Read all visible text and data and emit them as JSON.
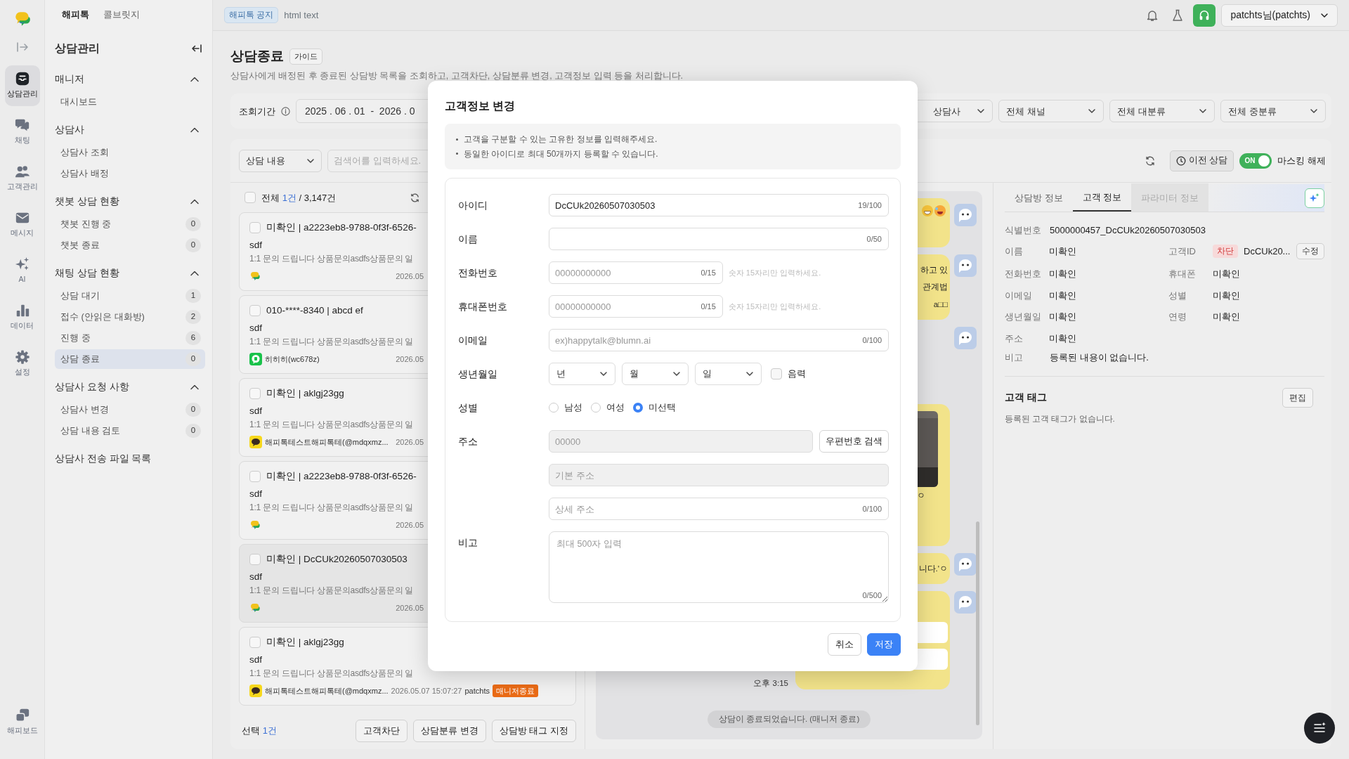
{
  "rail": {
    "items": [
      {
        "label": "상담관리",
        "selected": true
      },
      {
        "label": "채팅",
        "selected": false
      },
      {
        "label": "고객관리",
        "selected": false
      },
      {
        "label": "메시지",
        "selected": false
      },
      {
        "label": "AI",
        "selected": false
      },
      {
        "label": "데이터",
        "selected": false
      },
      {
        "label": "설정",
        "selected": false
      }
    ],
    "bottom": {
      "label": "해피보드"
    }
  },
  "sidebar": {
    "tabs": [
      {
        "label": "해피톡",
        "selected": true
      },
      {
        "label": "콜브릿지",
        "selected": false
      }
    ],
    "title": "상담관리",
    "groups": [
      {
        "title": "매니저",
        "expanded": true,
        "items": [
          {
            "label": "대시보드",
            "selected": false
          }
        ]
      },
      {
        "title": "상담사",
        "expanded": true,
        "items": [
          {
            "label": "상담사 조회",
            "selected": false
          },
          {
            "label": "상담사 배정",
            "selected": false
          }
        ]
      },
      {
        "title": "챗봇 상담 현황",
        "expanded": true,
        "items": [
          {
            "label": "챗봇 진행 중",
            "count": "0",
            "selected": false
          },
          {
            "label": "챗봇 종료",
            "count": "0",
            "selected": false
          }
        ]
      },
      {
        "title": "채팅 상담 현황",
        "expanded": true,
        "items": [
          {
            "label": "상담 대기",
            "count": "1",
            "selected": false
          },
          {
            "label": "접수 (안읽은 대화방)",
            "count": "2",
            "selected": false
          },
          {
            "label": "진행 중",
            "count": "6",
            "selected": false
          },
          {
            "label": "상담 종료",
            "count": "0",
            "selected": true
          }
        ]
      },
      {
        "title": "상담사 요청 사항",
        "expanded": true,
        "items": [
          {
            "label": "상담사 변경",
            "count": "0",
            "selected": false
          },
          {
            "label": "상담 내용 검토",
            "count": "0",
            "selected": false
          }
        ]
      }
    ],
    "links": [
      "상담사 전송 파일 목록"
    ]
  },
  "topbar": {
    "notice_badge": "해피톡 공지",
    "notice_text": "html text",
    "user": "patchts님(patchts)"
  },
  "page": {
    "title": "상담종료",
    "guide": "가이드",
    "description": "상담사에게 배정된 후 종료된 상담방 목록을 조회하고, 고객차단, 상담분류 변경, 고객정보 입력 등을 처리합니다."
  },
  "filters": {
    "period_label": "조회기간",
    "date_range": "2025 . 06 . 01  -  2026 . 0",
    "selects": [
      "상담사",
      "전체 채널",
      "전체 대분류",
      "전체 중분류"
    ]
  },
  "toolbar": {
    "search_type": "상담 내용",
    "search": {
      "placeholder": "검색어를 입력하세요."
    },
    "previous_button": "이전 상담",
    "masking": {
      "switch": "ON",
      "on": true,
      "label": "마스킹 해제"
    }
  },
  "list": {
    "checked": false,
    "total_label": "전체",
    "matched": "1건",
    "total": "/ 3,147건",
    "items": [
      {
        "title": "미확인 | a2223eb8-9788-0f3f-6526-",
        "subject": "sdf",
        "preview": "1:1 문의 드립니다 상품문의asdfs상품문의 일",
        "kind": "happytalk",
        "date": "2026.05",
        "checked": false,
        "selected": false
      },
      {
        "title": "010-****-8340 | abcd ef",
        "subject": "sdf",
        "preview": "1:1 문의 드립니다 상품문의asdfs상품문의 일",
        "kind": "naver",
        "channel_name": "히히히(wc678z)",
        "date": "2026.05",
        "checked": false,
        "selected": false
      },
      {
        "title": "미확인 | aklgj23gg",
        "subject": "sdf",
        "preview": "1:1 문의 드립니다 상품문의asdfs상품문의 일",
        "kind": "kakao",
        "channel_name": "해피톡테스트해피톡테(@mdqxmz...",
        "date": "2026.05",
        "checked": false,
        "selected": false
      },
      {
        "title": "미확인 | a2223eb8-9788-0f3f-6526-",
        "subject": "sdf",
        "preview": "1:1 문의 드립니다 상품문의asdfs상품문의 일",
        "kind": "happytalk",
        "date": "2026.05",
        "checked": false,
        "selected": false
      },
      {
        "title": "미확인 | DcCUk20260507030503",
        "subject": "sdf",
        "preview": "1:1 문의 드립니다 상품문의asdfs상품문의 일",
        "kind": "happytalk",
        "date": "2026.05",
        "checked": false,
        "selected": true
      },
      {
        "title": "미확인 | aklgj23gg",
        "subject": "sdf",
        "preview": "1:1 문의 드립니다 상품문의asdfs상품문의 일",
        "kind": "kakao",
        "channel_name": "해피톡테스트해피톡테(@mdqxmz...",
        "date": "2026.05.07 15:07:27",
        "agent": "patchts",
        "status": "매니저종료",
        "checked": false,
        "selected": false
      }
    ],
    "selection_label": "선택",
    "selection_count": "1건",
    "actions": [
      "고객차단",
      "상담분류 변경",
      "상담방 태그 지정"
    ]
  },
  "chat": {
    "messages": [
      {
        "kind": "emoji"
      },
      {
        "kind": "text",
        "lines": [
          "하고 있",
          "관계법",
          "a□□"
        ]
      },
      {
        "lines": [
          "ㅇ"
        ]
      },
      {
        "kind": "text",
        "lines": [
          "니다.'ㅇ"
        ]
      },
      {
        "kind": "form",
        "time": "오후 3:15"
      }
    ],
    "system": "상담이 종료되었습니다. (매니저 종료)"
  },
  "info": {
    "tabs": [
      {
        "label": "상담방 정보",
        "selected": false,
        "disabled": false
      },
      {
        "label": "고객 정보",
        "selected": true,
        "disabled": false
      },
      {
        "label": "파라미터 정보",
        "selected": false,
        "disabled": true
      }
    ],
    "id_label": "식별번호",
    "id_value": "5000000457_DcCUk20260507030503",
    "fields": [
      {
        "label": "이름",
        "value": "미확인"
      },
      {
        "label": "고객ID",
        "value": "DcCUk20...",
        "badge": "차단",
        "action": "수정"
      },
      {
        "label": "전화번호",
        "value": "미확인"
      },
      {
        "label": "휴대폰",
        "value": "미확인"
      },
      {
        "label": "이메일",
        "value": "미확인"
      },
      {
        "label": "성별",
        "value": "미확인"
      },
      {
        "label": "생년월일",
        "value": "미확인"
      },
      {
        "label": "연령",
        "value": "미확인"
      },
      {
        "label": "주소",
        "value": "미확인"
      }
    ],
    "note_label": "비고",
    "note_value": "등록된 내용이 없습니다.",
    "tags_title": "고객 태그",
    "tags_edit": "편집",
    "tags_empty": "등록된 고객 태그가 없습니다."
  },
  "modal": {
    "title": "고객정보 변경",
    "notes": [
      "고객을 구분할 수 있는 고유한 정보를 입력해주세요.",
      "동일한 아이디로 최대 50개까지 등록할 수 있습니다."
    ],
    "fields": [
      {
        "kind": "text",
        "label": "아이디",
        "value": "DcCUk20260507030503",
        "counter": "19/100"
      },
      {
        "kind": "text",
        "label": "이름",
        "counter": "0/50"
      },
      {
        "kind": "short",
        "label": "전화번호",
        "placeholder": "00000000000",
        "counter": "0/15",
        "hint": "숫자 15자리만 입력하세요."
      },
      {
        "kind": "short",
        "label": "휴대폰번호",
        "placeholder": "00000000000",
        "counter": "0/15",
        "hint": "숫자 15자리만 입력하세요."
      },
      {
        "kind": "text",
        "label": "이메일",
        "placeholder": "ex)happytalk@blumn.ai",
        "counter": "0/100"
      },
      {
        "kind": "date",
        "label": "생년월일",
        "selects": [
          "년",
          "월",
          "일"
        ],
        "lunar": {
          "label": "음력",
          "checked": false
        }
      },
      {
        "kind": "radio",
        "label": "성별",
        "options": [
          {
            "label": "남성",
            "selected": false
          },
          {
            "label": "여성",
            "selected": false
          },
          {
            "label": "미선택",
            "selected": true
          }
        ]
      },
      {
        "kind": "address",
        "label": "주소",
        "postcode": {
          "placeholder": "00000",
          "disabled": true
        },
        "search_button": "우편번호 검색",
        "base": {
          "placeholder": "기본 주소",
          "disabled": true
        },
        "detail": {
          "placeholder": "상세 주소",
          "counter": "0/100"
        }
      },
      {
        "kind": "textarea",
        "label": "비고",
        "placeholder": "최대 500자 입력",
        "counter": "0/500"
      }
    ],
    "buttons": [
      {
        "label": "취소",
        "kind": "secondary"
      },
      {
        "label": "저장",
        "kind": "primary"
      }
    ]
  }
}
